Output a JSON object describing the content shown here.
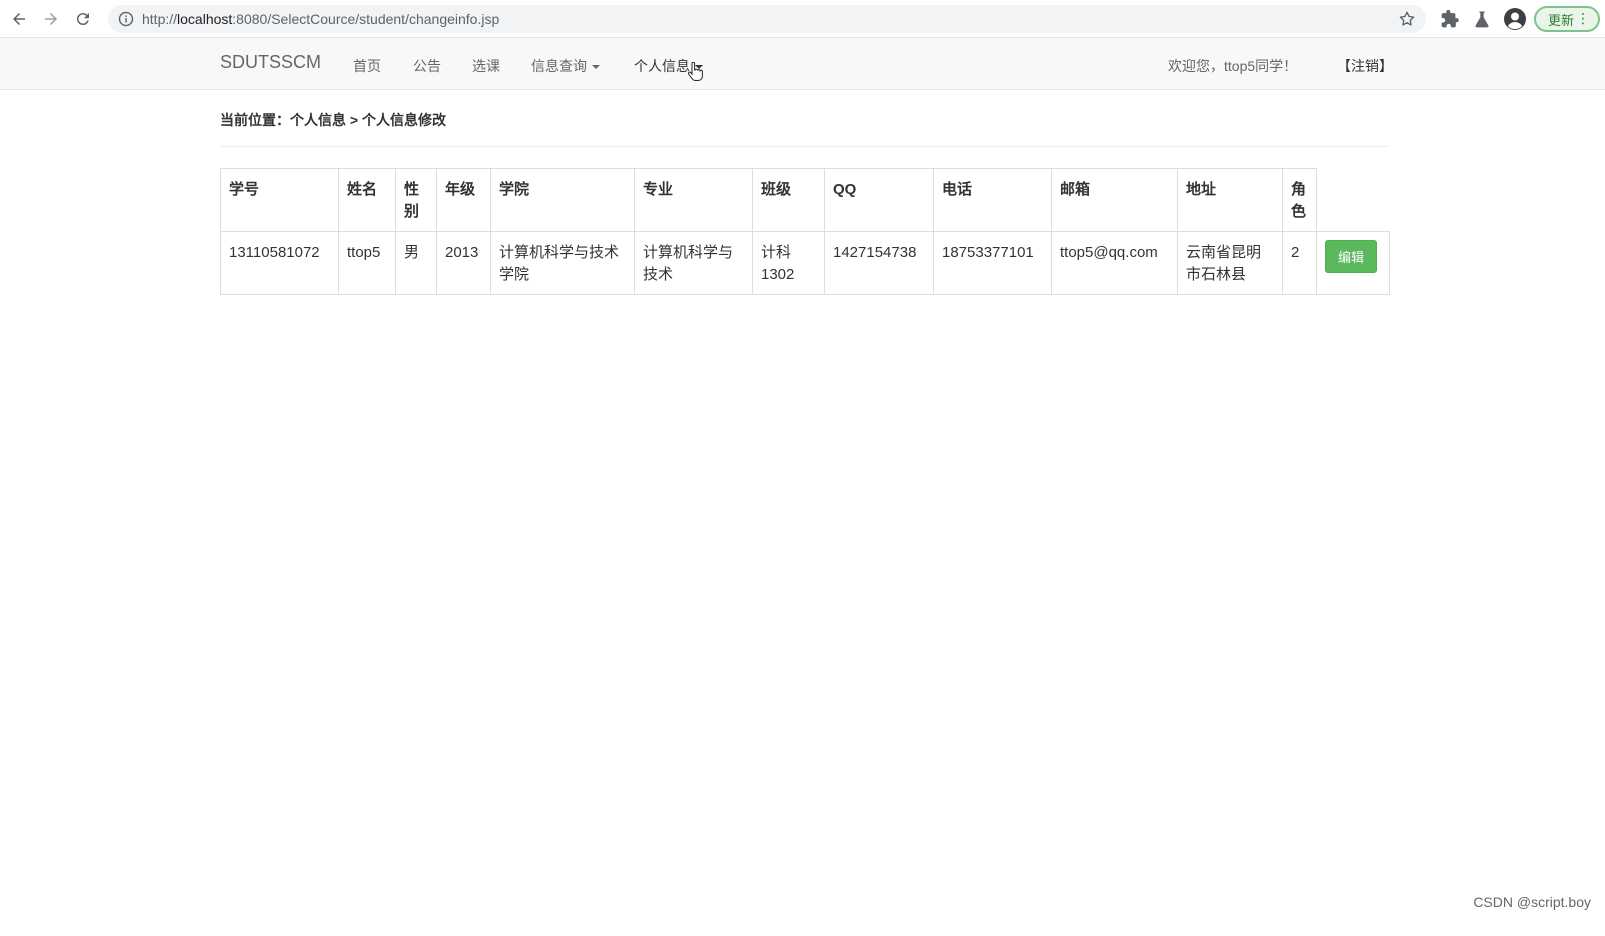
{
  "browser": {
    "url_prefix": "http://",
    "url_host": "localhost",
    "url_rest": ":8080/SelectCource/student/changeinfo.jsp",
    "update_label": "更新",
    "menu_dots": "⋮"
  },
  "navbar": {
    "brand": "SDUTSSCM",
    "items": [
      {
        "label": "首页"
      },
      {
        "label": "公告"
      },
      {
        "label": "选课"
      },
      {
        "label": "信息查询"
      },
      {
        "label": "个人信息"
      }
    ],
    "welcome": "欢迎您，ttop5同学！",
    "logout": "【注销】"
  },
  "breadcrumb": "当前位置：个人信息 > 个人信息修改",
  "table": {
    "headers": [
      "学号",
      "姓名",
      "性别",
      "年级",
      "学院",
      "专业",
      "班级",
      "QQ",
      "电话",
      "邮箱",
      "地址",
      "角色"
    ],
    "row": {
      "student_id": "13110581072",
      "name": "ttop5",
      "gender": "男",
      "grade": "2013",
      "college": "计算机科学与技术学院",
      "major": "计算机科学与技术",
      "class": "计科1302",
      "qq": "1427154738",
      "phone": "18753377101",
      "email": "ttop5@qq.com",
      "address": "云南省昆明市石林县",
      "role": "2"
    },
    "edit_label": "编辑"
  },
  "watermark": "CSDN @script.boy"
}
